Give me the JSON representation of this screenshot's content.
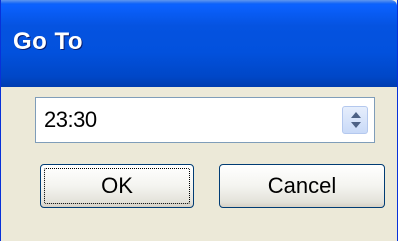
{
  "window": {
    "title": "Go To"
  },
  "time_field": {
    "value": "23:30",
    "spin_up_icon": "triangle-up",
    "spin_down_icon": "triangle-down"
  },
  "buttons": {
    "ok_label": "OK",
    "cancel_label": "Cancel"
  },
  "colors": {
    "titlebar": "#0553e0",
    "face": "#ece9d8",
    "field_border": "#7f9db9",
    "button_border": "#003c74"
  }
}
